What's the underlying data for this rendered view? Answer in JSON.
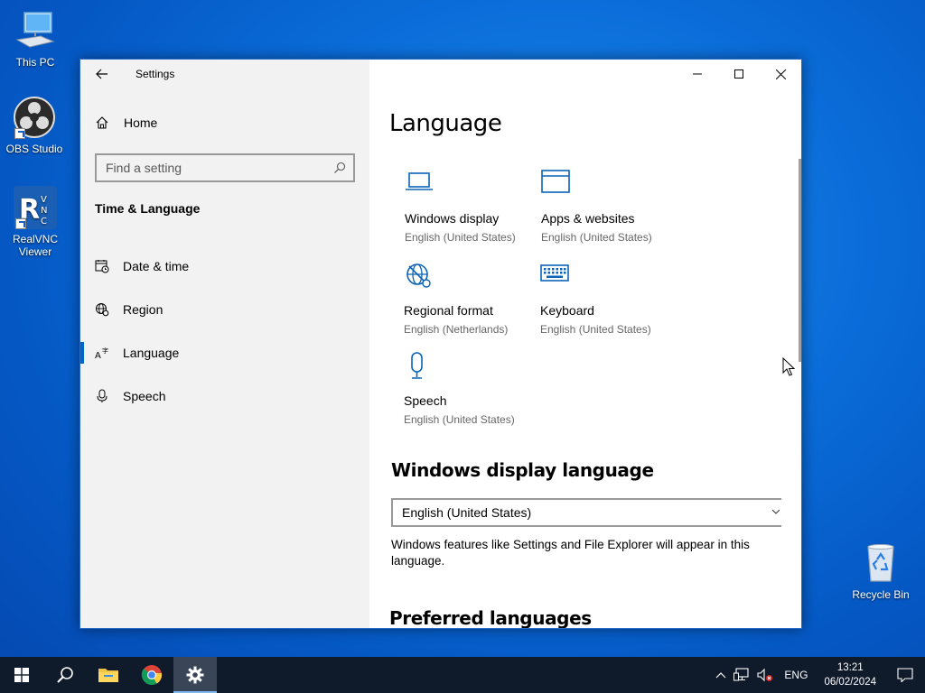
{
  "desktop": {
    "icons": [
      {
        "label": "This PC"
      },
      {
        "label": "OBS Studio"
      },
      {
        "label": "RealVNC Viewer"
      },
      {
        "label": "Recycle Bin"
      }
    ]
  },
  "window": {
    "title": "Settings",
    "sidebar": {
      "home_label": "Home",
      "search_placeholder": "Find a setting",
      "section_title": "Time & Language",
      "items": [
        {
          "label": "Date & time",
          "icon": "calendar-clock-icon"
        },
        {
          "label": "Region",
          "icon": "globe-icon"
        },
        {
          "label": "Language",
          "icon": "language-icon",
          "active": true
        },
        {
          "label": "Speech",
          "icon": "microphone-icon"
        }
      ]
    },
    "main": {
      "title": "Language",
      "tiles": [
        {
          "name": "Windows display",
          "sub": "English (United States)",
          "icon": "laptop-icon"
        },
        {
          "name": "Apps & websites",
          "sub": "English (United States)",
          "icon": "window-icon"
        },
        {
          "name": "Regional format",
          "sub": "English (Netherlands)",
          "icon": "regional-format-icon"
        },
        {
          "name": "Keyboard",
          "sub": "English (United States)",
          "icon": "keyboard-icon"
        },
        {
          "name": "Speech",
          "sub": "English (United States)",
          "icon": "microphone-icon"
        }
      ],
      "display_language_title": "Windows display language",
      "display_language_value": "English (United States)",
      "display_language_desc": "Windows features like Settings and File Explorer will appear in this language.",
      "preferred_title": "Preferred languages"
    }
  },
  "taskbar": {
    "lang": "ENG",
    "time": "13:21",
    "date": "06/02/2024"
  },
  "colors": {
    "accent": "#0067c0",
    "icon_blue": "#0a63b8",
    "taskbar": "#0f1a2b"
  }
}
